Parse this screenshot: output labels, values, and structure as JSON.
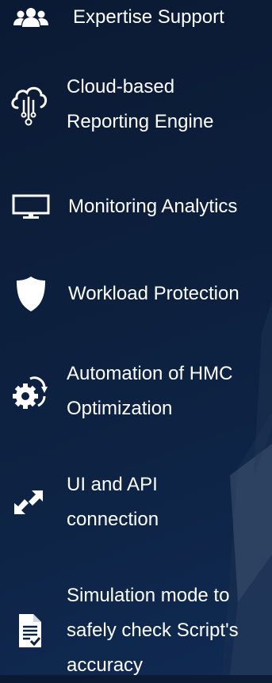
{
  "features": [
    {
      "label": "Expertise Support",
      "icon": "users-icon"
    },
    {
      "label": "Cloud-based Reporting Engine",
      "icon": "cloud-network-icon"
    },
    {
      "label": "Monitoring Analytics",
      "icon": "monitor-icon"
    },
    {
      "label": "Workload Protection",
      "icon": "shield-icon"
    },
    {
      "label": "Automation of HMC Optimization",
      "icon": "gear-refresh-icon"
    },
    {
      "label": "UI and API connection",
      "icon": "expand-arrows-icon"
    },
    {
      "label": "Simulation mode to safely check Script's accuracy",
      "icon": "document-check-icon"
    }
  ],
  "colors": {
    "background": "#0d2140",
    "text": "#ffffff"
  }
}
